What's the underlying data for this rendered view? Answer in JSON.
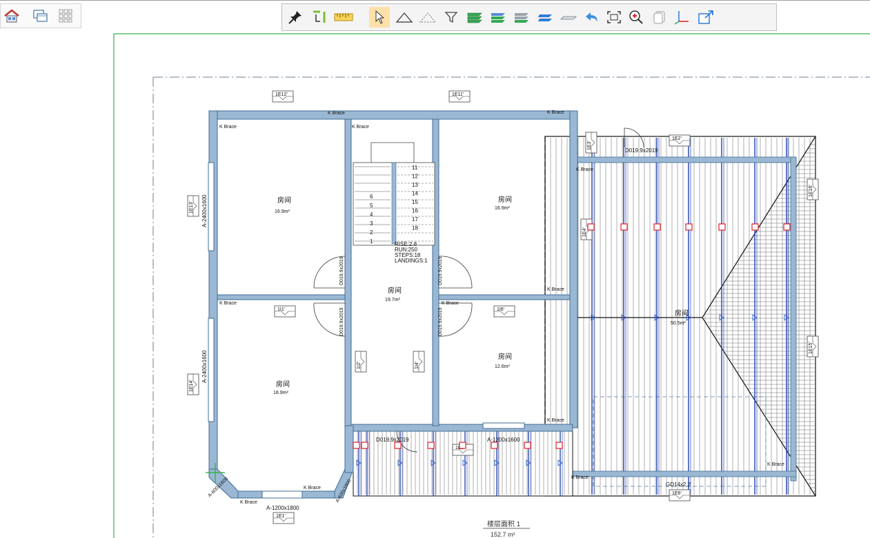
{
  "left_toolbar": {
    "buttons": [
      {
        "name": "home-view-button",
        "icon": "house-icon"
      },
      {
        "name": "window-view-button",
        "icon": "window-icon"
      },
      {
        "name": "grid-view-button",
        "icon": "grid-icon"
      }
    ]
  },
  "main_toolbar": {
    "buttons": [
      {
        "name": "pin-button",
        "icon": "pin-icon"
      },
      {
        "name": "bracket-button",
        "icon": "bracket-tool-icon"
      },
      {
        "name": "measure-button",
        "icon": "ruler-icon"
      },
      {
        "name": "select-button",
        "icon": "cursor-icon",
        "active": true
      },
      {
        "name": "roof-button",
        "icon": "roof-icon"
      },
      {
        "name": "roof-outline-button",
        "icon": "roof-outline-icon"
      },
      {
        "name": "filter-button",
        "icon": "filter-icon"
      },
      {
        "name": "layers-green-button",
        "icon": "layers-icon"
      },
      {
        "name": "layers-blue-green-button",
        "icon": "layers-icon"
      },
      {
        "name": "layers-gray-green-button",
        "icon": "layers-icon"
      },
      {
        "name": "layer-single-button",
        "icon": "layer-icon"
      },
      {
        "name": "plane-button",
        "icon": "plane-icon"
      },
      {
        "name": "undo-button",
        "icon": "undo-arrow-icon"
      },
      {
        "name": "zoom-extents-button",
        "icon": "frame-icon"
      },
      {
        "name": "zoom-in-button",
        "icon": "zoom-in-icon"
      },
      {
        "name": "copy-button",
        "icon": "copy-icon"
      },
      {
        "name": "axes-button",
        "icon": "axes-icon"
      },
      {
        "name": "export-button",
        "icon": "export-icon"
      }
    ]
  },
  "colors": {
    "wall": "#7ea2c2",
    "wall_dark": "#3f6b94",
    "joist": "#1d3fae",
    "red_mark": "#e01d2a",
    "frame_green": "#39b54a"
  },
  "plan": {
    "tags": {
      "tag_top_left": "1E12'",
      "tag_top_right": "1E11'",
      "tag_left_upper": "1E13'",
      "tag_left_lower": "1E14'",
      "tag_bottom": "1E1'",
      "tag_mid_left": "1I1'",
      "tag_mid_right": "1I6'",
      "tag_center_left": "1I2'",
      "tag_center_right": "1I4'",
      "tag_right_side": "1E16'",
      "tag_right_side2": "1E15'",
      "tag_corner": "1E2'",
      "tag_corner2": "1E3'",
      "tag_lower": "1E5'",
      "tag_door_bottom": "1E4'",
      "tag_right_bottom": "1E6'"
    },
    "rooms": [
      {
        "label": "房间",
        "area": "16.9m²"
      },
      {
        "label": "房间",
        "area": "16.9m²"
      },
      {
        "label": "房间",
        "area": "19.7m²"
      },
      {
        "label": "房间",
        "area": "12.6m²"
      },
      {
        "label": "房间",
        "area": "18.9m²"
      },
      {
        "label": "房间",
        "area": "50.5m²"
      }
    ],
    "brace_label": "K Brace",
    "stair": {
      "line1": "RISE:2.8",
      "line2": "RUN:250",
      "line3": "STEPS:18",
      "line4": "LANDINGS:1",
      "step_numbers": [
        "11",
        "12",
        "13",
        "14",
        "15",
        "16",
        "17",
        "18"
      ],
      "left_numbers": [
        "6",
        "5",
        "4",
        "3",
        "2",
        "1"
      ]
    },
    "windows": {
      "left_top": "A-2400x1600",
      "left_bottom": "A-2400x1600",
      "bottom": "A-1200x1800",
      "corner_left": "A-600x1800",
      "corner_right": "A-600x1800",
      "porch": "A-1200x1600"
    },
    "doors": {
      "door1": "D019.9x2019",
      "door2": "D019.9x2019",
      "door3": "D019.9x2019",
      "door4": "D019.9x2019",
      "door5": "D019.9x2019",
      "porch_door": "D019.9x2019",
      "garage": "GD14x2.2"
    },
    "floor_area_label": "楼层面积 1",
    "floor_area_value": "152.7 m²"
  }
}
